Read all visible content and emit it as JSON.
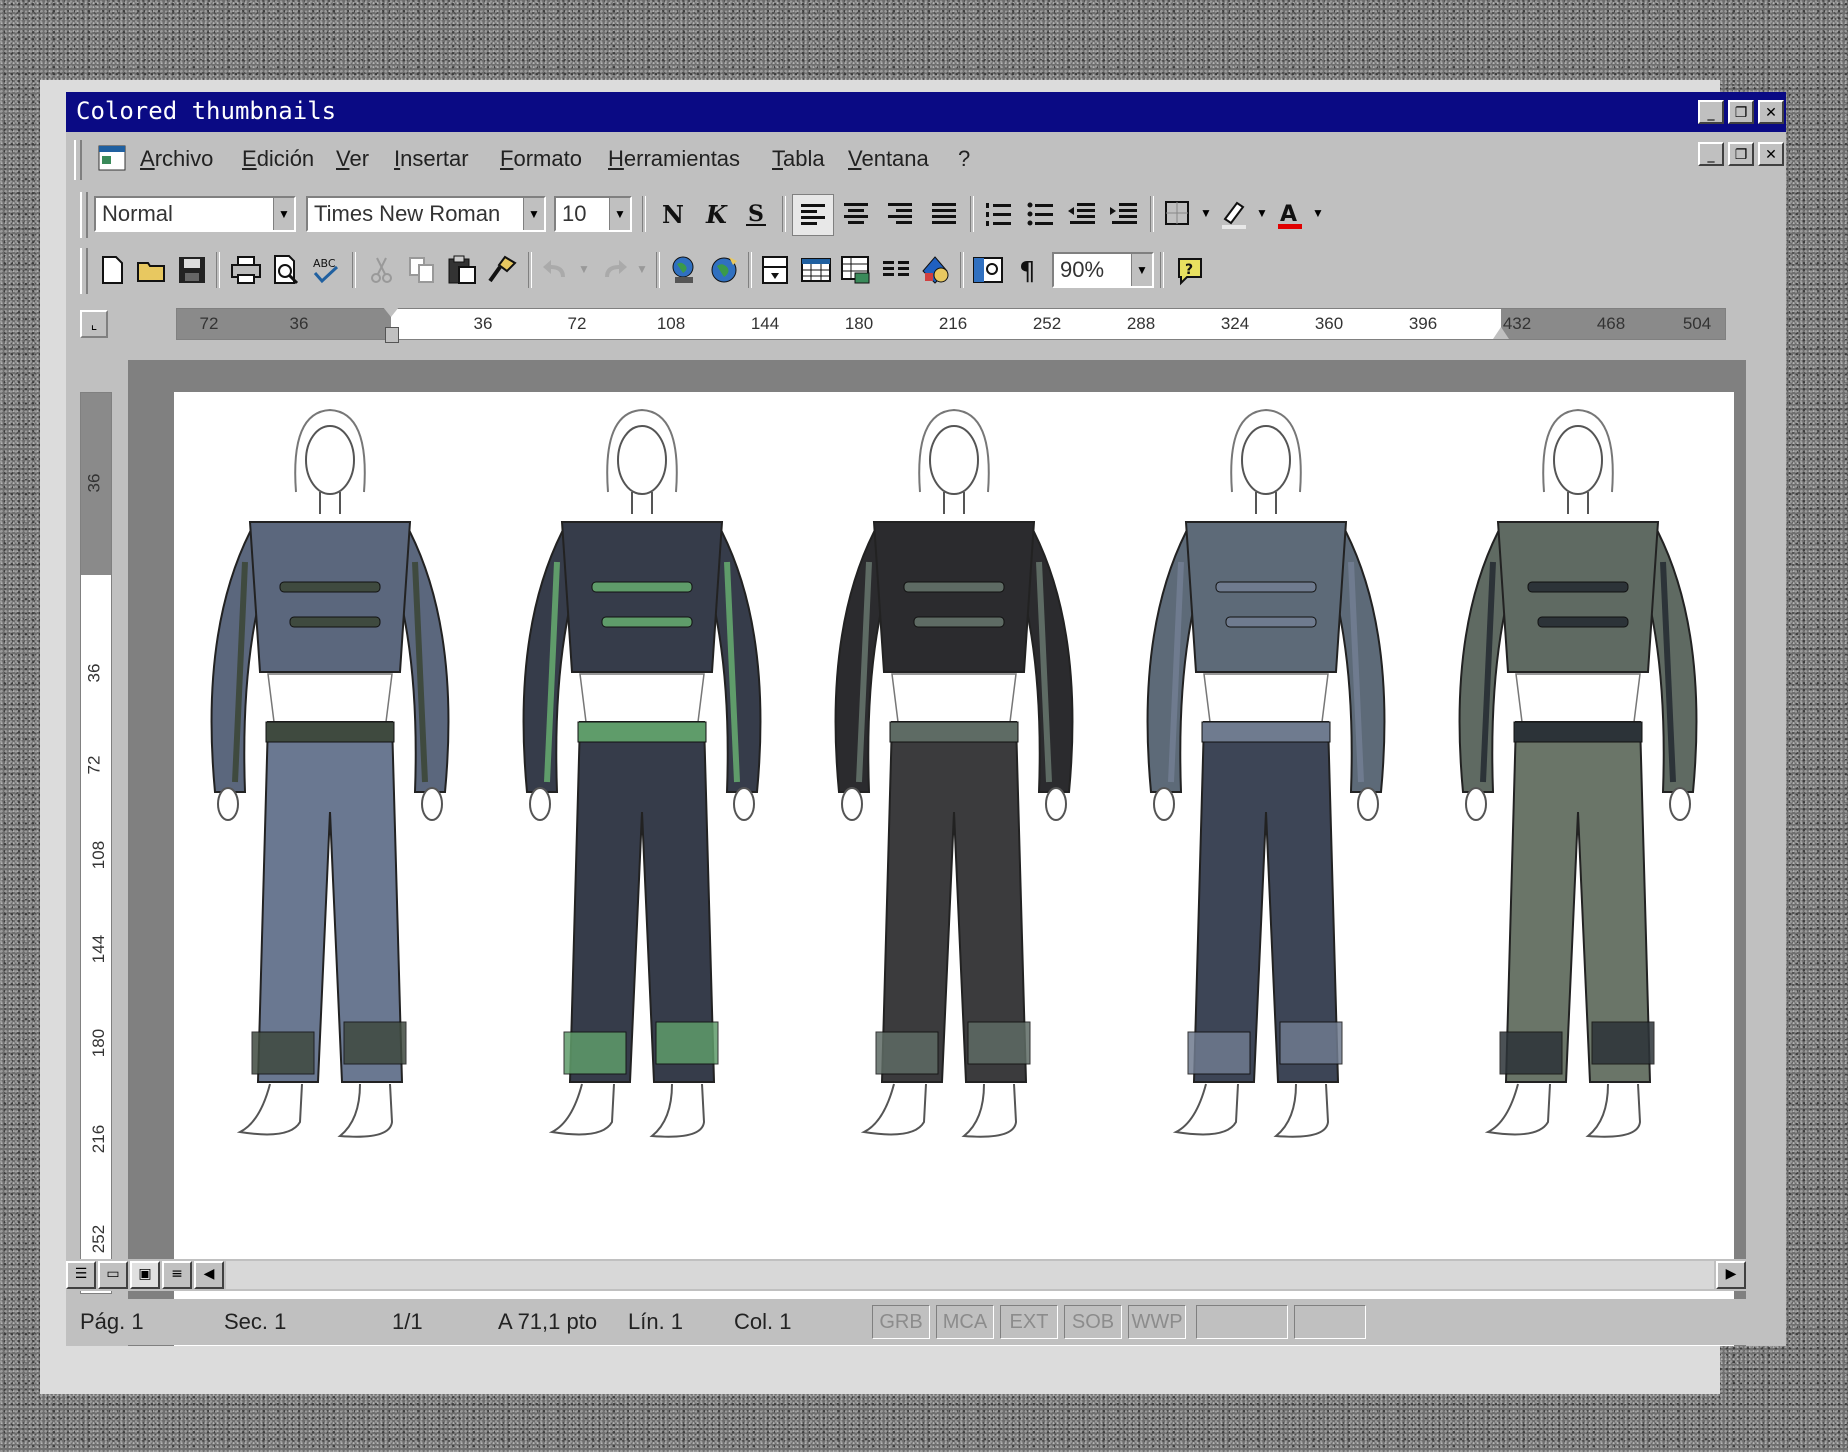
{
  "window": {
    "title": "Colored thumbnails"
  },
  "menu": [
    "Archivo",
    "Edición",
    "Ver",
    "Insertar",
    "Formato",
    "Herramientas",
    "Tabla",
    "Ventana",
    "?"
  ],
  "formatting": {
    "style": "Normal",
    "font": "Times New Roman",
    "size": "10"
  },
  "standard": {
    "zoom": "90%"
  },
  "ruler": {
    "h_labels": [
      "72",
      "36",
      "36",
      "72",
      "108",
      "144",
      "180",
      "216",
      "252",
      "288",
      "324",
      "360",
      "396",
      "432",
      "468",
      "504"
    ],
    "v_labels": [
      "36",
      "36",
      "72",
      "108",
      "144",
      "180",
      "216",
      "252"
    ]
  },
  "status": {
    "page": "Pág. 1",
    "section": "Sec. 1",
    "pages": "1/1",
    "position": "A 71,1 pto",
    "line": "Lín. 1",
    "col": "Col. 1",
    "modes": [
      "GRB",
      "MCA",
      "EXT",
      "SOB",
      "WWP"
    ]
  },
  "figures": [
    {
      "name": "look-1",
      "top": "#5b677d",
      "bottom": "#6a7891",
      "accent": "#3f4a3f"
    },
    {
      "name": "look-2",
      "top": "#363c4a",
      "bottom": "#363c4a",
      "accent": "#5f9c6a"
    },
    {
      "name": "look-3",
      "top": "#2b2b2e",
      "bottom": "#3b3b3d",
      "accent": "#5e6b64"
    },
    {
      "name": "look-4",
      "top": "#5d6a78",
      "bottom": "#3d4556",
      "accent": "#6f7b8f"
    },
    {
      "name": "look-5",
      "top": "#5f6a62",
      "bottom": "#6a7568",
      "accent": "#2c3338"
    }
  ]
}
